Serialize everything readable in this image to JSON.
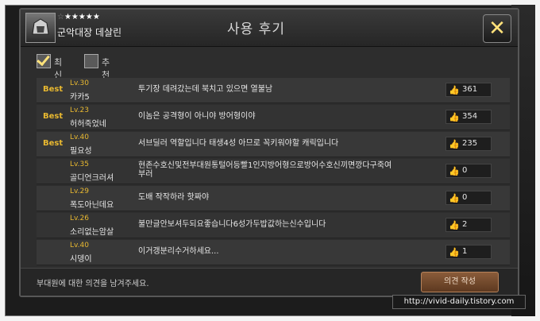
{
  "header": {
    "title": "사용 후기",
    "hero_name": "군악대장 데살린",
    "star_rating": 5,
    "close_icon": "close-icon"
  },
  "filters": {
    "latest_label": "최신",
    "recommended_label": "추천",
    "latest_checked": true,
    "recommended_checked": false
  },
  "reviews": [
    {
      "badge": "Best",
      "level": "Lv.30",
      "user": "카카5",
      "comment": "투기장 데려갔는데 북치고 있으면 열불남",
      "likes": "361"
    },
    {
      "badge": "Best",
      "level": "Lv.23",
      "user": "허허죽었네",
      "comment": "이놈은 공격형이 아니야 방어형이야",
      "likes": "354"
    },
    {
      "badge": "Best",
      "level": "Lv.40",
      "user": "필요성",
      "comment": "서브딜러 역할입니다 태생4성 아므로 꼭키워야할 캐릭입니다",
      "likes": "235"
    },
    {
      "badge": "",
      "level": "Lv.35",
      "user": "골디언크러셔",
      "comment": "현존수호신및전부대원통털어등빨1인지방어형으로방어수호신끼면깡다구죽여 부러",
      "likes": "0"
    },
    {
      "badge": "",
      "level": "Lv.29",
      "user": "폭도아닌데요",
      "comment": "도배 작작하라 핫짜야",
      "likes": "0"
    },
    {
      "badge": "",
      "level": "Lv.26",
      "user": "소리없는암살",
      "comment": "불만글안보셔두되요좋습니다6성가두밥값하는신수입니다",
      "likes": "2"
    },
    {
      "badge": "",
      "level": "Lv.40",
      "user": "시뎅이",
      "comment": "이거갱분리수거하세요...",
      "likes": "1"
    }
  ],
  "footer": {
    "prompt": "부대원에 대한 의견을 남겨주세요.",
    "write_button": "의견 작성"
  },
  "watermark": "http://vivid-daily.tistory.com",
  "colors": {
    "accent_gold": "#e8b830",
    "close_yellow": "#ffe27a",
    "button_brown": "#7a4b2c"
  }
}
